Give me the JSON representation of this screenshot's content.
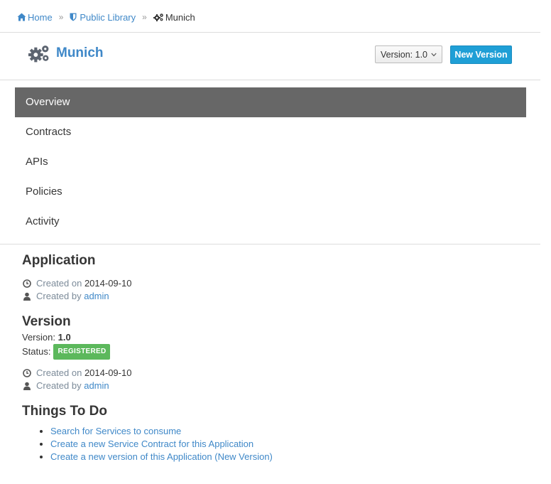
{
  "breadcrumb": {
    "home": "Home",
    "library": "Public Library",
    "current": "Munich",
    "separator": "»"
  },
  "header": {
    "title": "Munich",
    "version_select": "Version: 1.0",
    "new_version_button": "New Version"
  },
  "nav": {
    "items": [
      "Overview",
      "Contracts",
      "APIs",
      "Policies",
      "Activity"
    ],
    "active": "Overview"
  },
  "application": {
    "heading": "Application",
    "created_on_label": "Created on",
    "created_on": "2014-09-10",
    "created_by_label": "Created by",
    "created_by": "admin"
  },
  "version": {
    "heading": "Version",
    "version_label": "Version:",
    "version_value": "1.0",
    "status_label": "Status:",
    "status_value": "REGISTERED",
    "created_on_label": "Created on",
    "created_on": "2014-09-10",
    "created_by_label": "Created by",
    "created_by": "admin"
  },
  "todo": {
    "heading": "Things To Do",
    "items": [
      "Search for Services to consume",
      "Create a new Service Contract for this Application",
      "Create a new version of this Application (New Version)"
    ]
  },
  "colors": {
    "link": "#3f88c8",
    "nav_active_bg": "#676767",
    "primary_button": "#1f9fd6",
    "status_badge": "#5cb85c"
  }
}
